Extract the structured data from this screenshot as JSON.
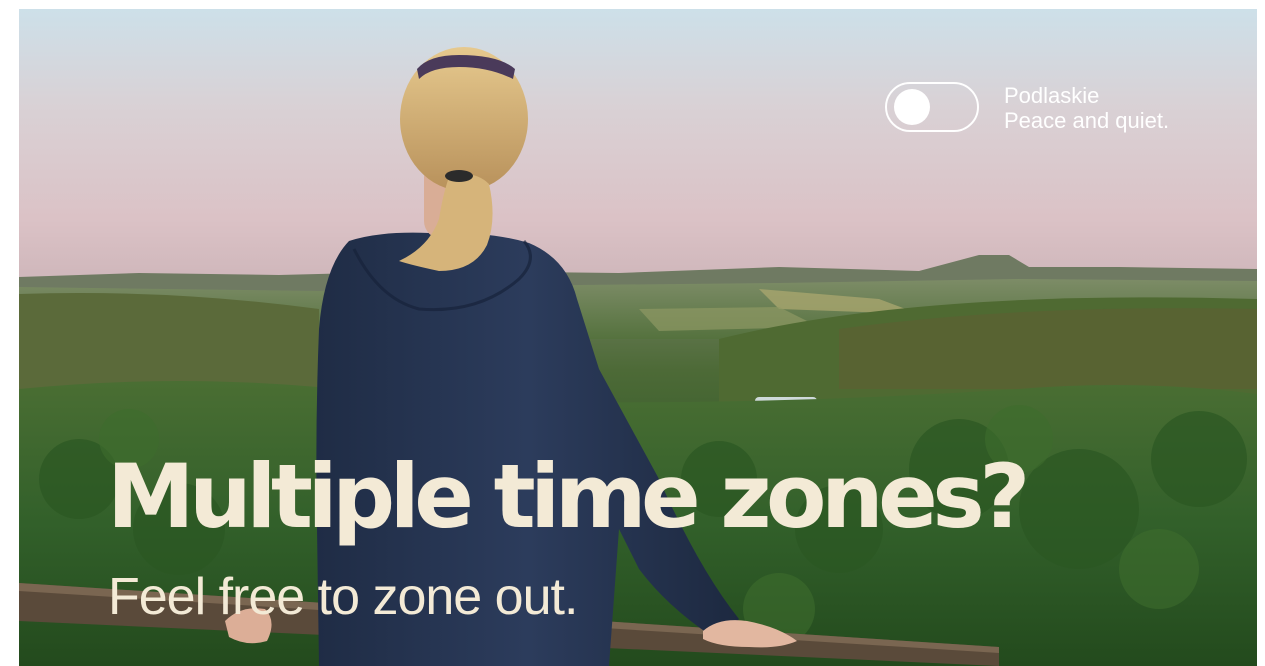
{
  "brand": {
    "line1": "Podlaskie",
    "line2": "Peace and quiet."
  },
  "headline": "Multiple time zones?",
  "subline": "Feel free to zone out.",
  "colors": {
    "headline_text": "#f3ead6",
    "brand_text": "#ffffff",
    "sky_top": "#cfe0ea",
    "sky_pink": "#d9c4c8",
    "forest_green": "#2f5a26",
    "hoodie_navy": "#273552"
  },
  "toggle": {
    "icon": "toggle-switch-icon",
    "state": "off"
  }
}
